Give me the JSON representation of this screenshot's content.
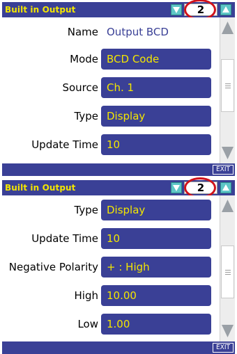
{
  "screens": [
    {
      "title": "Built in Output",
      "page_number": "2",
      "exit_label": "EXIT",
      "name_row": {
        "label": "Name",
        "value": "Output BCD"
      },
      "rows": [
        {
          "label": "Mode",
          "value": "BCD Code"
        },
        {
          "label": "Source",
          "value": "Ch. 1"
        },
        {
          "label": "Type",
          "value": "Display"
        },
        {
          "label": "Update Time",
          "value": "10"
        }
      ]
    },
    {
      "title": "Built in Output",
      "page_number": "2",
      "exit_label": "EXIT",
      "rows": [
        {
          "label": "Type",
          "value": "Display"
        },
        {
          "label": "Update Time",
          "value": "10"
        },
        {
          "label": "Negative Polarity",
          "value": "+ : High"
        },
        {
          "label": "High",
          "value": "10.00"
        },
        {
          "label": "Low",
          "value": "1.00"
        }
      ]
    }
  ],
  "colors": {
    "title_bar": "#3a4096",
    "title_text": "#f3e600",
    "value_box": "#3a4096",
    "value_text": "#f3e600",
    "page_arrow": "#5ec6c6",
    "highlight_circle": "#d0121b"
  },
  "icons": {
    "page_prev": "triangle-down-icon",
    "page_next": "triangle-up-icon",
    "scroll_up": "scroll-up-arrow-icon",
    "scroll_down": "scroll-down-arrow-icon"
  }
}
